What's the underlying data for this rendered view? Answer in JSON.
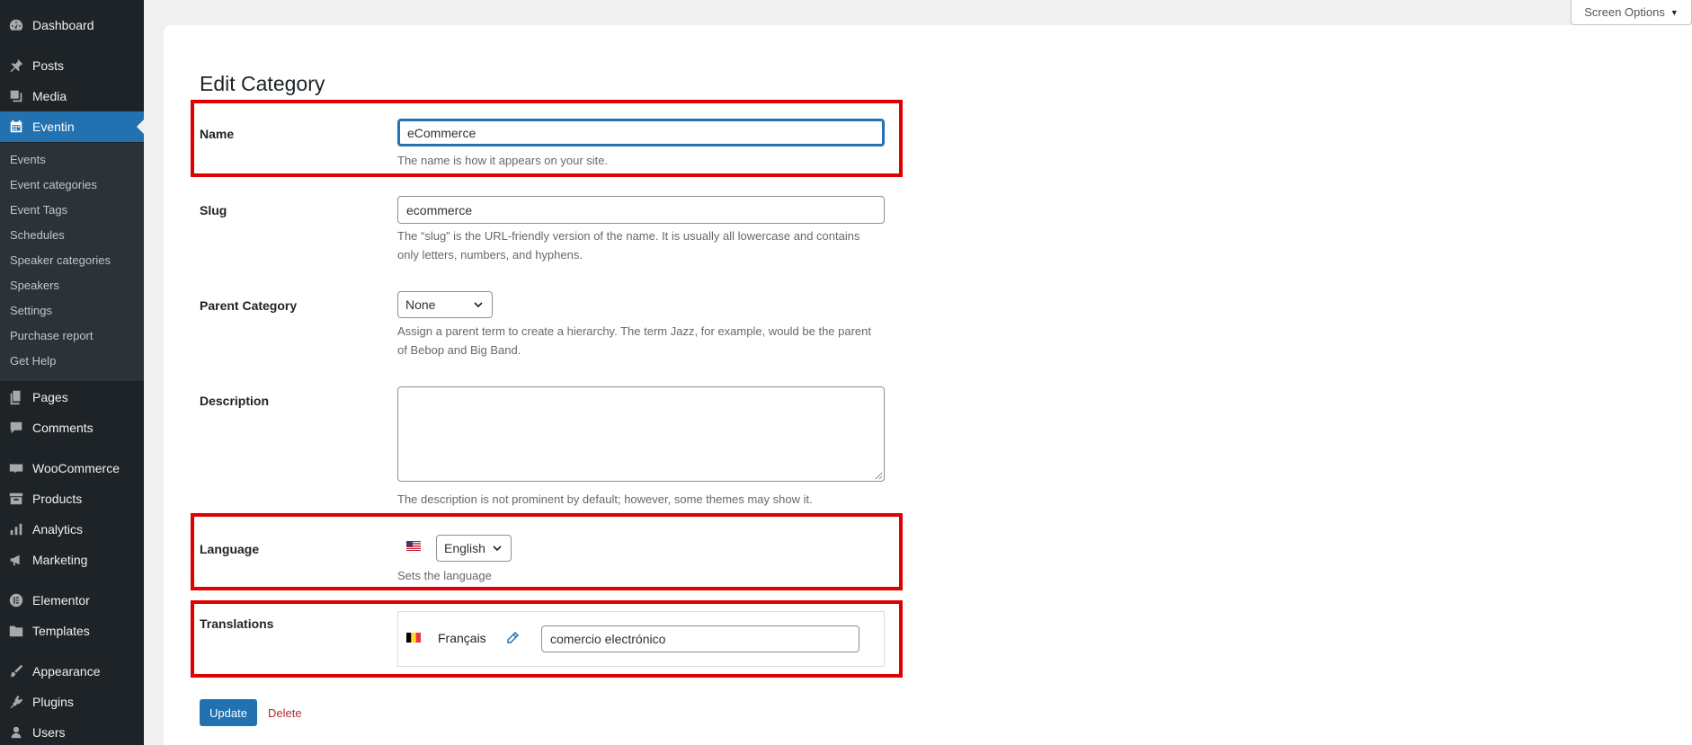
{
  "sidebar": {
    "items": [
      {
        "label": "Dashboard",
        "icon": "dashboard-icon"
      },
      {
        "label": "Posts",
        "icon": "pin-icon"
      },
      {
        "label": "Media",
        "icon": "media-icon"
      },
      {
        "label": "Eventin",
        "icon": "calendar-icon"
      },
      {
        "label": "Pages",
        "icon": "pages-icon"
      },
      {
        "label": "Comments",
        "icon": "comment-icon"
      },
      {
        "label": "WooCommerce",
        "icon": "woo-icon"
      },
      {
        "label": "Products",
        "icon": "archive-icon"
      },
      {
        "label": "Analytics",
        "icon": "bar-chart-icon"
      },
      {
        "label": "Marketing",
        "icon": "megaphone-icon"
      },
      {
        "label": "Elementor",
        "icon": "elementor-icon"
      },
      {
        "label": "Templates",
        "icon": "folder-icon"
      },
      {
        "label": "Appearance",
        "icon": "brush-icon"
      },
      {
        "label": "Plugins",
        "icon": "plugin-icon"
      },
      {
        "label": "Users",
        "icon": "user-icon"
      }
    ],
    "submenu": [
      "Events",
      "Event categories",
      "Event Tags",
      "Schedules",
      "Speaker categories",
      "Speakers",
      "Settings",
      "Purchase report",
      "Get Help"
    ]
  },
  "header": {
    "screen_options": "Screen Options"
  },
  "page": {
    "title": "Edit Category"
  },
  "form": {
    "name": {
      "label": "Name",
      "value": "eCommerce",
      "help": "The name is how it appears on your site."
    },
    "slug": {
      "label": "Slug",
      "value": "ecommerce",
      "help": "The “slug” is the URL-friendly version of the name. It is usually all lowercase and contains only letters, numbers, and hyphens."
    },
    "parent": {
      "label": "Parent Category",
      "value": "None",
      "help": "Assign a parent term to create a hierarchy. The term Jazz, for example, would be the parent of Bebop and Big Band."
    },
    "description": {
      "label": "Description",
      "value": "",
      "help": "The description is not prominent by default; however, some themes may show it."
    },
    "language": {
      "label": "Language",
      "value": "English",
      "help": "Sets the language"
    },
    "translations": {
      "label": "Translations",
      "language": "Français",
      "value": "comercio electrónico"
    }
  },
  "actions": {
    "update": "Update",
    "delete": "Delete"
  },
  "colors": {
    "accent": "#2271b1",
    "sidebar": "#1d2327",
    "highlight_box": "#e00000",
    "delete": "#b32d2e"
  }
}
